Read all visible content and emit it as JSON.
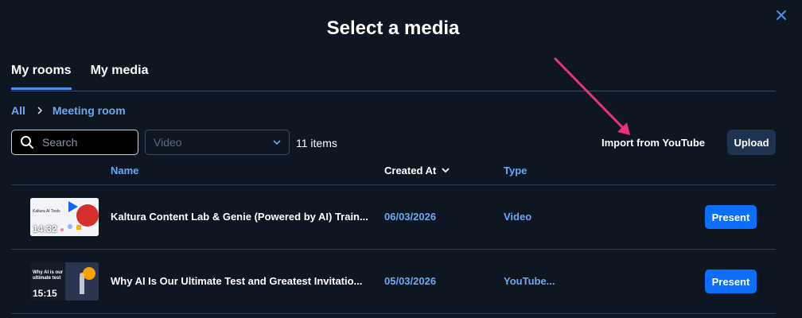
{
  "dialog": {
    "title": "Select a media"
  },
  "tabs": [
    {
      "label": "My rooms",
      "active": true
    },
    {
      "label": "My media",
      "active": false
    }
  ],
  "breadcrumb": {
    "root": "All",
    "current": "Meeting room"
  },
  "filters": {
    "search_placeholder": "Search",
    "type_select_value": "Video",
    "item_count": "11 items"
  },
  "actions": {
    "import_label": "Import from YouTube",
    "upload_label": "Upload"
  },
  "table": {
    "headers": {
      "name": "Name",
      "created": "Created At",
      "type": "Type"
    },
    "rows": [
      {
        "thumb_duration": "14:32",
        "thumb_caption": "Kaltura AI Tools",
        "name": "Kaltura Content Lab & Genie (Powered by AI) Train...",
        "created": "06/03/2026",
        "type": "Video",
        "action": "Present"
      },
      {
        "thumb_duration": "15:15",
        "thumb_caption": "Why AI is our ultimate test",
        "name": "Why AI Is Our Ultimate Test and Greatest Invitatio...",
        "created": "05/03/2026",
        "type": "YouTube...",
        "action": "Present"
      }
    ]
  },
  "colors": {
    "background": "#0e1621",
    "accent": "#0d6efd",
    "link": "#6aa9f5",
    "annotation_arrow": "#e8337a"
  },
  "icons": [
    "close-icon",
    "search-icon",
    "chevron-down-icon",
    "sort-down-icon",
    "annotation-arrow-icon"
  ]
}
